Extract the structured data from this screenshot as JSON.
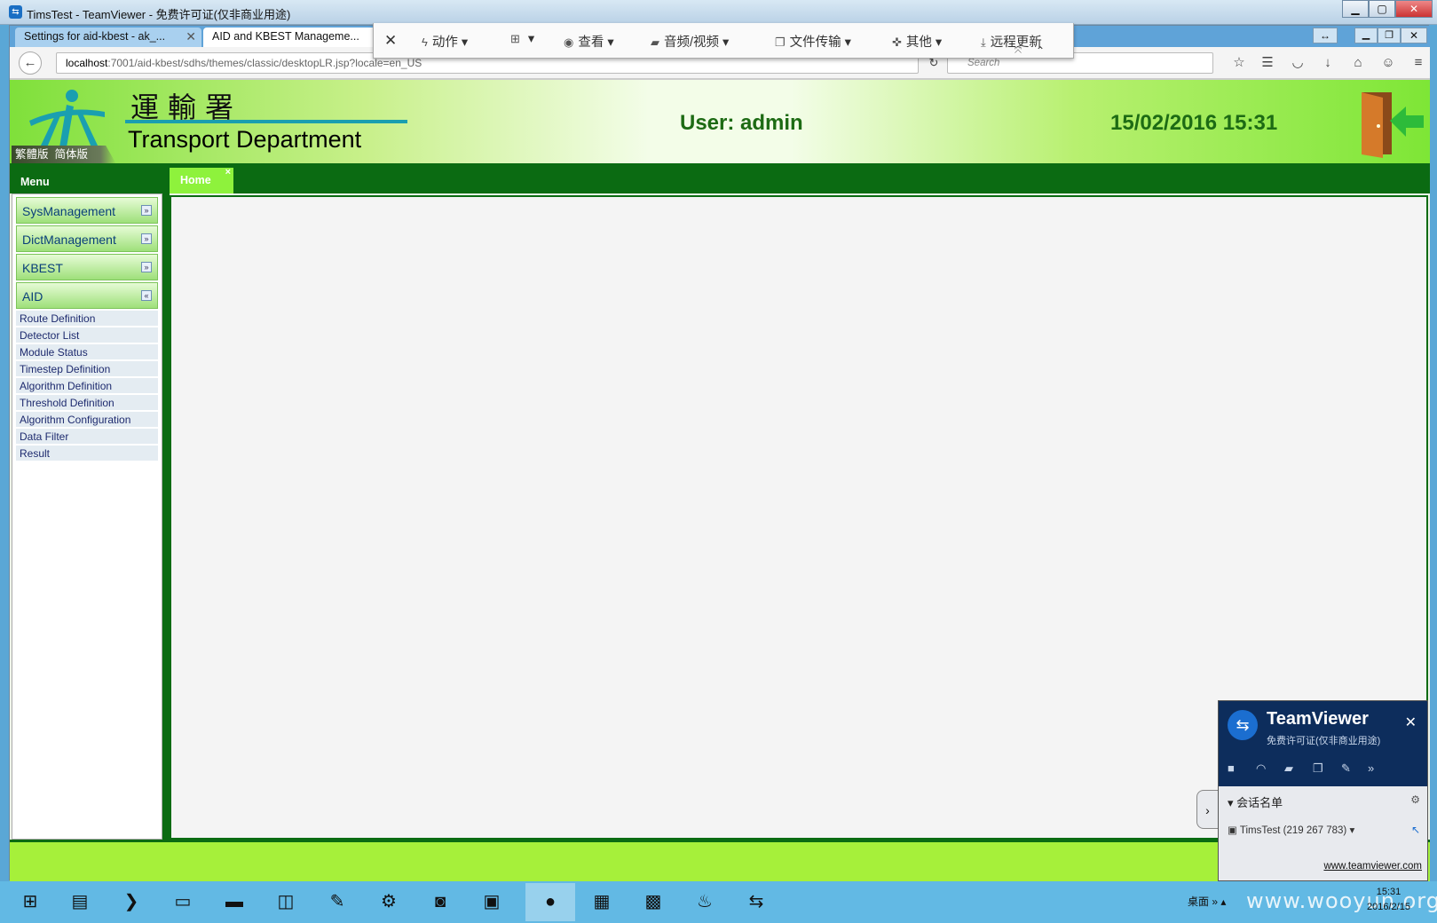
{
  "tv_window": {
    "title": "TimsTest - TeamViewer - 免费许可证(仅非商业用途)",
    "minimize": "▁",
    "maximize": "▢",
    "close": "✕"
  },
  "browser": {
    "tabs": [
      {
        "label": "Settings for aid-kbest - ak_..."
      },
      {
        "label": "AID and KBEST Manageme..."
      }
    ],
    "url_host": "localhost",
    "url_path": ":7001/aid-kbest/sdhs/themes/classic/desktopLR.jsp?locale=en_US",
    "search_placeholder": "Search"
  },
  "tv_toolbar": {
    "close": "✕",
    "items": [
      {
        "label": "动作",
        "icon": "lightning-icon"
      },
      {
        "label": "",
        "icon": "windows-icon"
      },
      {
        "label": "查看",
        "icon": "eye-icon"
      },
      {
        "label": "音频/视频",
        "icon": "chat-icon"
      },
      {
        "label": "文件传输",
        "icon": "file-icon"
      },
      {
        "label": "其他",
        "icon": "puzzle-icon"
      },
      {
        "label": "远程更新",
        "icon": "download-icon"
      }
    ]
  },
  "header": {
    "chinese_title": "運輸署",
    "department": "Transport Department",
    "user_label": "User:  admin",
    "datetime": "15/02/2016 15:31",
    "lang_traditional": "繁體版",
    "lang_simplified": "简体版"
  },
  "menu": {
    "title": "Menu",
    "home_tab": "Home",
    "sections": [
      {
        "label": "SysManagement",
        "expanded": false
      },
      {
        "label": "DictManagement",
        "expanded": false
      },
      {
        "label": "KBEST",
        "expanded": false
      },
      {
        "label": "AID",
        "expanded": true
      }
    ],
    "aid_items": [
      "Route Definition",
      "Detector List",
      "Module Status",
      "Timestep Definition",
      "Algorithm Definition",
      "Threshold Definition",
      "Algorithm Configuration",
      "Data Filter",
      "Result"
    ]
  },
  "teamviewer_panel": {
    "name": "TeamViewer",
    "subtitle": "免费许可证(仅非商业用途)",
    "session_list": "会话名单",
    "entry": "TimsTest (219 267 783)",
    "link": "www.teamviewer.com"
  },
  "taskbar": {
    "tray_text": "桌面",
    "time": "15:31",
    "date": "2016/2/15",
    "watermark": "www.wooyun.org"
  }
}
